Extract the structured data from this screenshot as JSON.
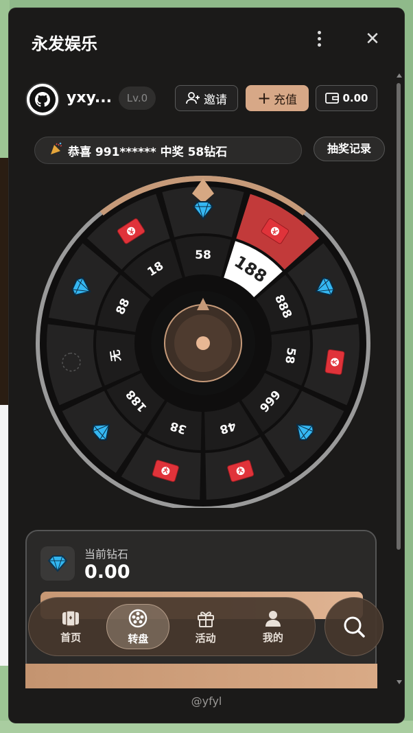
{
  "app": {
    "title": "永发娱乐"
  },
  "user": {
    "name": "yxy...",
    "level": "Lv.0"
  },
  "actions": {
    "invite": "邀请",
    "recharge": "充值",
    "wallet_balance": "0.00"
  },
  "ticker": {
    "text": "恭喜 991****** 中奖 58钻石"
  },
  "draw_record": "抽奖记录",
  "wheel": {
    "inner_labels": [
      "58",
      "188",
      "888",
      "58",
      "666",
      "48",
      "38",
      "188",
      "无",
      "88",
      "18"
    ],
    "outer_prizes": [
      "diamond-icon",
      "red-envelope-icon",
      "diamond-icon",
      "red-envelope-icon",
      "diamond-icon",
      "red-envelope-icon",
      "red-envelope-icon",
      "diamond-icon",
      "empty-icon",
      "diamond-icon",
      "red-envelope-icon"
    ],
    "highlight_label": "188",
    "colors": {
      "ring": "#c69a79",
      "highlight": "#c23a3a",
      "segment": "#242323"
    }
  },
  "balance": {
    "label": "当前钻石",
    "value": "0.00"
  },
  "nav": {
    "items": [
      {
        "label": "首页",
        "icon": "home-card-icon"
      },
      {
        "label": "转盘",
        "icon": "wheel-icon"
      },
      {
        "label": "活动",
        "icon": "gift-icon"
      },
      {
        "label": "我的",
        "icon": "user-icon"
      }
    ],
    "active": "转盘"
  },
  "footer": "@yfyl"
}
